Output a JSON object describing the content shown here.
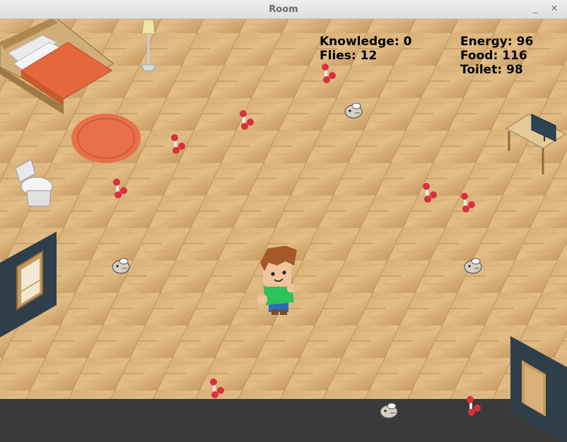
{
  "window": {
    "title": "Room",
    "minimize_glyph": "_",
    "close_glyph": "✕"
  },
  "hud": {
    "knowledge_label": "Knowledge:",
    "knowledge_value": "0",
    "flies_label": "Flies:",
    "flies_value": "12",
    "energy_label": "Energy:",
    "energy_value": "96",
    "food_label": "Food:",
    "food_value": "116",
    "toilet_label": "Toilet:",
    "toilet_value": "98"
  },
  "colors": {
    "floor_light": "#d9b27a",
    "floor_dark": "#b88d55",
    "bottom_strip": "#3a3a3a",
    "bed_cover": "#e5673c",
    "rug": "#e8704a",
    "mushroom_cap": "#d8313c",
    "wall_panel": "#2f3f4a",
    "shirt": "#2cc35a",
    "hair": "#a5582a"
  },
  "icons": {
    "fly": "fly-icon",
    "mushroom": "mushroom-icon"
  }
}
